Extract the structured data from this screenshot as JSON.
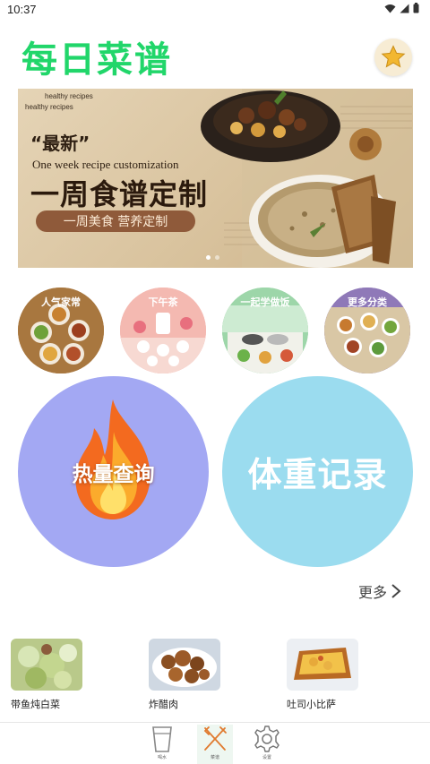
{
  "status_bar": {
    "time": "10:37"
  },
  "header": {
    "title": "每日菜谱",
    "favorite_icon": "star-icon"
  },
  "banner": {
    "sub1": "healthy recipes",
    "sub2": "healthy recipes",
    "headline_new": "“最新”",
    "headline_en": "One week recipe customization",
    "headline_main": "一周食谱定制",
    "pill": "一周美食 营养定制"
  },
  "categories": [
    {
      "label": "人气家常"
    },
    {
      "label": "下午茶"
    },
    {
      "label": "一起学做饭"
    },
    {
      "label": "更多分类"
    }
  ],
  "features": {
    "calorie_label": "热量查询",
    "weight_label": "体重记录"
  },
  "more": {
    "label": "更多"
  },
  "recipes": [
    {
      "name": "带鱼炖白菜"
    },
    {
      "name": "炸醋肉"
    },
    {
      "name": "吐司小比萨"
    }
  ],
  "bottom_nav": {
    "items": [
      {
        "label": "喝水",
        "icon": "cup-icon"
      },
      {
        "label": "菜谱",
        "icon": "fork-knife-icon"
      },
      {
        "label": "设置",
        "icon": "gear-icon"
      }
    ]
  },
  "colors": {
    "title_green": "#21d66a",
    "calorie_bg": "#a3a8f3",
    "weight_bg": "#9bdcef"
  }
}
